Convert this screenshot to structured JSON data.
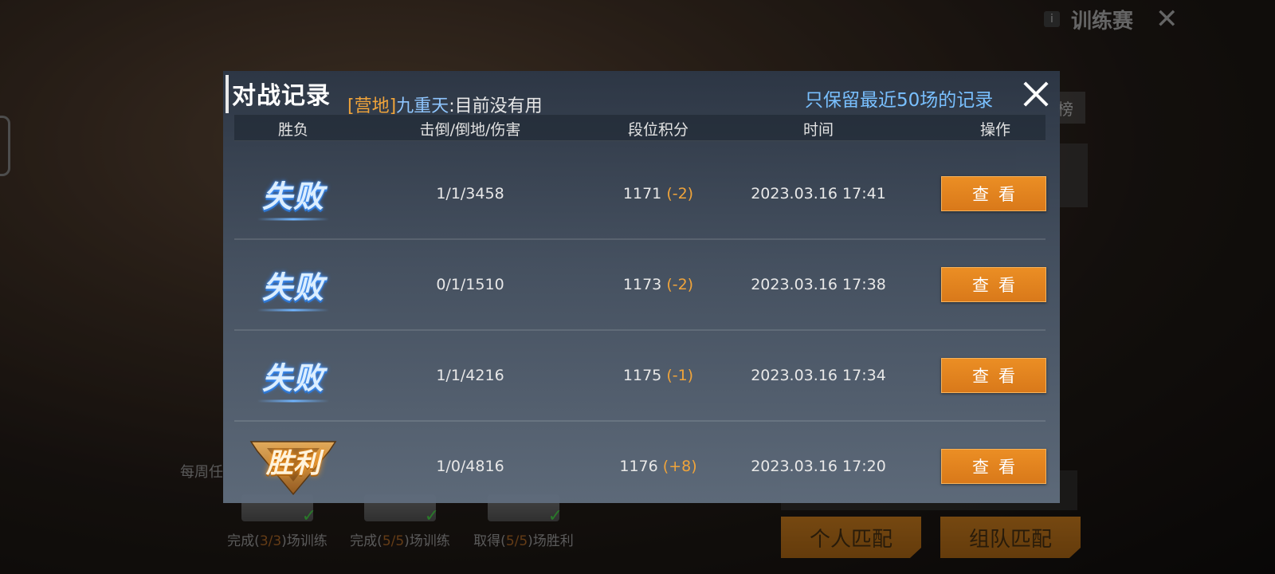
{
  "background": {
    "mode_label": "训练赛",
    "side_label": "榜",
    "weekly_label": "每周任",
    "tasks": [
      {
        "prefix": "完成(",
        "progress": "3/3",
        "suffix": ")场训练"
      },
      {
        "prefix": "完成(",
        "progress": "5/5",
        "suffix": ")场训练"
      },
      {
        "prefix": "取得(",
        "progress": "5/5",
        "suffix": ")场胜利"
      }
    ],
    "solo_match": "个人匹配",
    "team_match": "组队匹配"
  },
  "dialog": {
    "title": "对战记录",
    "subtitle_tag": "[营地]",
    "subtitle_name": "九重天",
    "subtitle_text": ":目前没有用",
    "note": "只保留最近50场的记录",
    "headers": {
      "result": "胜负",
      "kda": "击倒/倒地/伤害",
      "points": "段位积分",
      "time": "时间",
      "action": "操作"
    },
    "rows": [
      {
        "result": "失败",
        "kda": "1/1/3458",
        "points": "1171",
        "delta": "(-2)",
        "time": "2023.03.16 17:41",
        "action": "查看"
      },
      {
        "result": "失败",
        "kda": "0/1/1510",
        "points": "1173",
        "delta": "(-2)",
        "time": "2023.03.16 17:38",
        "action": "查看"
      },
      {
        "result": "失败",
        "kda": "1/1/4216",
        "points": "1175",
        "delta": "(-1)",
        "time": "2023.03.16 17:34",
        "action": "查看"
      },
      {
        "result": "胜利",
        "kda": "1/0/4816",
        "points": "1176",
        "delta": "(+8)",
        "time": "2023.03.16 17:20",
        "action": "查看"
      }
    ]
  },
  "colors": {
    "accent_orange": "#f0a43a",
    "note_blue": "#79c0ff",
    "button_orange": "#e1831f"
  }
}
